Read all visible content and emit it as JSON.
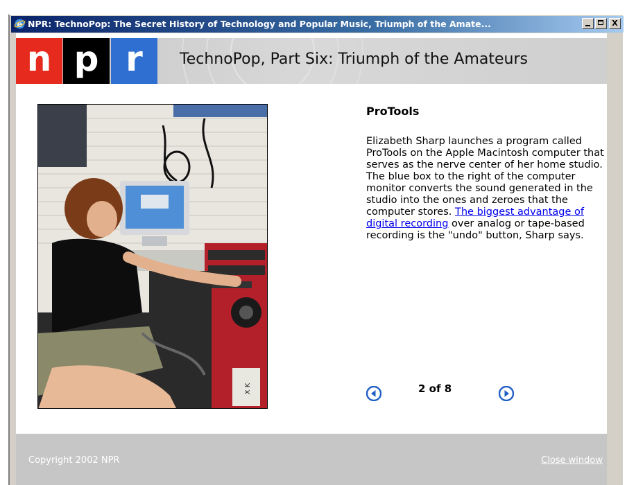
{
  "window": {
    "title": "NPR: TechnoPop: The Secret History of Technology and Popular Music, Triumph of the Amate...",
    "min_glyph": "_",
    "max_glyph": "□",
    "close_glyph": "X"
  },
  "banner": {
    "logo_letters": [
      "n",
      "p",
      "r"
    ],
    "logo_colors": [
      "#e62a1e",
      "#000000",
      "#2f6fd1"
    ],
    "title": "TechnoPop, Part Six: Triumph of the Amateurs"
  },
  "caption": {
    "heading": "ProTools",
    "body_before_link": "Elizabeth Sharp launches a program called ProTools on the Apple Macintosh computer that serves as the nerve center of her home studio. The blue box to the right of the computer monitor converts the sound generated in the studio into the ones and zeroes that the computer stores. ",
    "link_text": "The biggest advantage of digital recording",
    "body_after_link": " over analog or tape-based recording is the \"undo\" button, Sharp says."
  },
  "navigation": {
    "counter": "2 of 8",
    "prev_icon": "arrow-left-circle-icon",
    "next_icon": "arrow-right-circle-icon",
    "accent": "#1f5fc4"
  },
  "footer": {
    "copyright": "Copyright 2002 NPR",
    "close_link": "Close window"
  }
}
